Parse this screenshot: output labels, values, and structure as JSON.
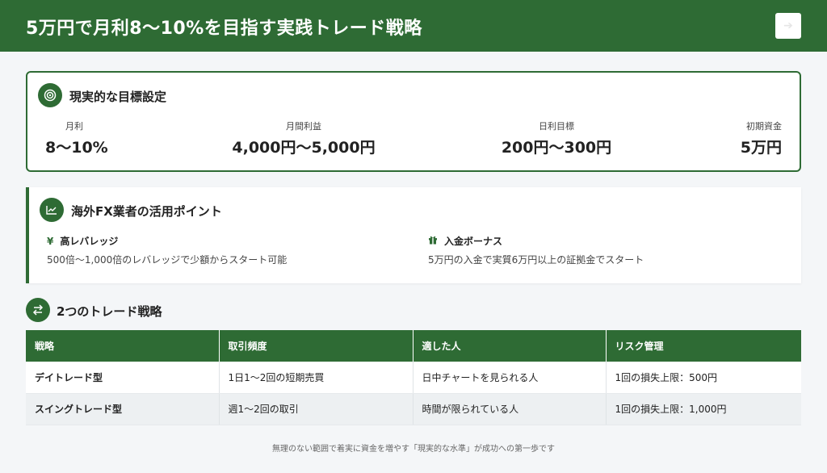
{
  "header": {
    "title": "5万円で月利8〜10%を目指す実践トレード戦略",
    "button_icon": "arrow-icon"
  },
  "goals": {
    "title": "現実的な目標設定",
    "icon": "target-icon",
    "metrics": [
      {
        "label": "月利",
        "value": "8〜10%"
      },
      {
        "label": "月間利益",
        "value": "4,000円〜5,000円"
      },
      {
        "label": "日利目標",
        "value": "200円〜300円"
      },
      {
        "label": "初期資金",
        "value": "5万円"
      }
    ]
  },
  "fx": {
    "title": "海外FX業者の活用ポイント",
    "icon": "chart-line-icon",
    "points": [
      {
        "icon": "yen-icon",
        "title": "高レバレッジ",
        "desc": "500倍〜1,000倍のレバレッジで少額からスタート可能"
      },
      {
        "icon": "gift-icon",
        "title": "入金ボーナス",
        "desc": "5万円の入金で実質6万円以上の証拠金でスタート"
      }
    ]
  },
  "strategies": {
    "title": "2つのトレード戦略",
    "icon": "exchange-icon",
    "columns": [
      "戦略",
      "取引頻度",
      "適した人",
      "リスク管理"
    ],
    "rows": [
      [
        "デイトレード型",
        "1日1〜2回の短期売買",
        "日中チャートを見られる人",
        "1回の損失上限：500円"
      ],
      [
        "スイングトレード型",
        "週1〜2回の取引",
        "時間が限られている人",
        "1回の損失上限：1,000円"
      ]
    ]
  },
  "footer": {
    "text": "無理のない範囲で着実に資金を増やす「現実的な水準」が成功への第一歩です"
  },
  "colors": {
    "primary": "#2e6b34",
    "background": "#f4f6f8"
  }
}
